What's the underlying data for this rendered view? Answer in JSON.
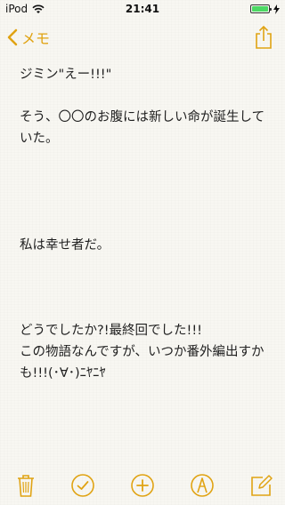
{
  "status_bar": {
    "carrier": "iPod",
    "time": "21:41"
  },
  "nav": {
    "back_label": "メモ"
  },
  "note": {
    "text": "ジミン\"えー!!!\"\n\nそう、〇〇のお腹には新しい命が誕生していた。\n\n\n\n\n私は幸せ者だ。\n\n\n\nどうでしたか?!最終回でした!!!\nこの物語なんですが、いつか番外編出すかも!!!(･∀･)ﾆﾔﾆﾔ"
  },
  "toolbar": {
    "icons": [
      "trash-icon",
      "checklist-icon",
      "add-icon",
      "markup-icon",
      "compose-icon"
    ]
  },
  "colors": {
    "accent": "#e0a313",
    "background": "#f8f7f2",
    "battery": "#4cd964"
  }
}
